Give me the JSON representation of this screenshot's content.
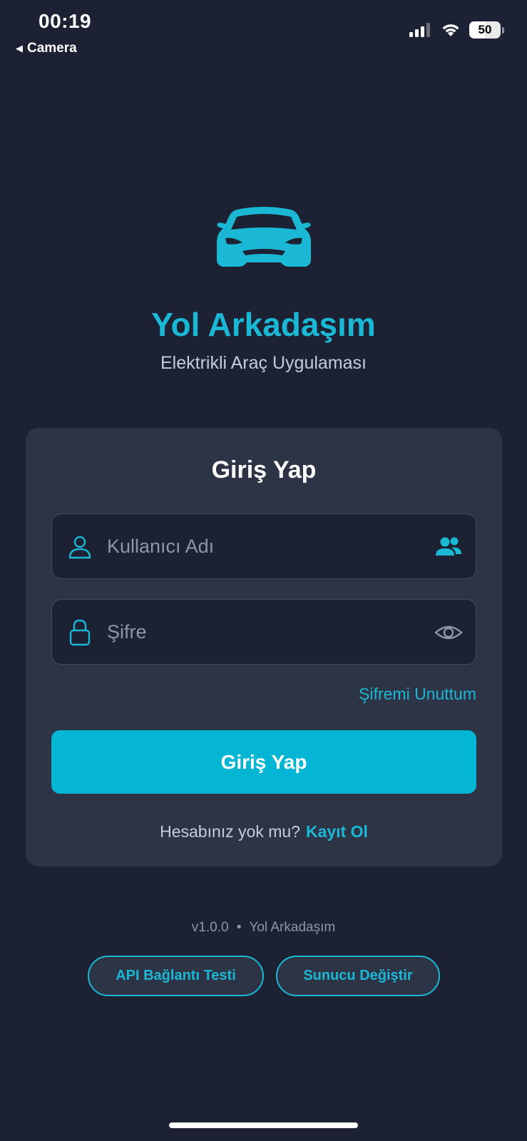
{
  "status_bar": {
    "time": "00:19",
    "back_label": "Camera",
    "battery_level": "50",
    "signal_icon": "cellular-signal-icon",
    "wifi_icon": "wifi-icon"
  },
  "hero": {
    "logo_icon": "car-icon",
    "title": "Yol Arkadaşım",
    "subtitle": "Elektrikli Araç Uygulaması"
  },
  "login_card": {
    "title": "Giriş Yap",
    "username": {
      "placeholder": "Kullanıcı Adı",
      "value": "",
      "lead_icon": "user-icon",
      "trail_icon": "users-icon"
    },
    "password": {
      "placeholder": "Şifre",
      "value": "",
      "lead_icon": "lock-icon",
      "trail_icon": "eye-icon"
    },
    "forgot_label": "Şifremi Unuttum",
    "submit_label": "Giriş Yap",
    "register_prompt": "Hesabınız yok mu?",
    "register_link": "Kayıt Ol"
  },
  "footer": {
    "version": "v1.0.0",
    "separator": "•",
    "app_name": "Yol Arkadaşım",
    "api_test_label": "API Bağlantı Testi",
    "change_server_label": "Sunucu Değiştir"
  },
  "colors": {
    "background": "#1c2233",
    "card": "#2d3446",
    "accent": "#04b5d4",
    "text_muted": "#8d96a8"
  }
}
